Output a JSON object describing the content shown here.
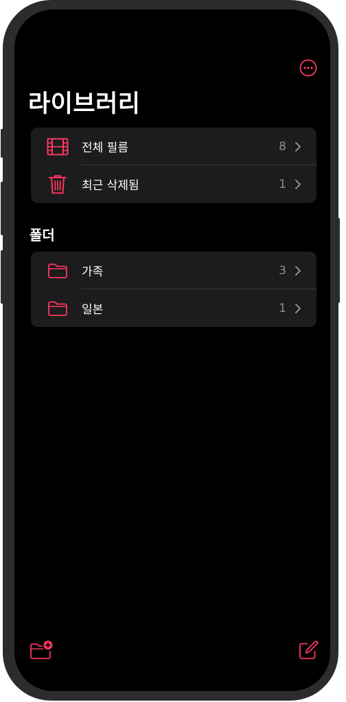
{
  "colors": {
    "accent": "#ff375f",
    "background": "#000000",
    "cell": "#1c1c1e",
    "secondary_text": "#8e8e93",
    "separator": "#38383a",
    "device_frame": "#2c2c2e"
  },
  "header": {
    "more_icon": "ellipsis-circle-icon",
    "title": "라이브러리"
  },
  "library": {
    "items": [
      {
        "icon": "film-icon",
        "label": "전체 필름",
        "count": "8"
      },
      {
        "icon": "trash-icon",
        "label": "최근 삭제됨",
        "count": "1"
      }
    ]
  },
  "folders": {
    "header": "폴더",
    "items": [
      {
        "icon": "folder-icon",
        "label": "가족",
        "count": "3"
      },
      {
        "icon": "folder-icon",
        "label": "일본",
        "count": "1"
      }
    ]
  },
  "toolbar": {
    "new_folder_icon": "folder-badge-plus-icon",
    "compose_icon": "square-and-pencil-icon"
  }
}
